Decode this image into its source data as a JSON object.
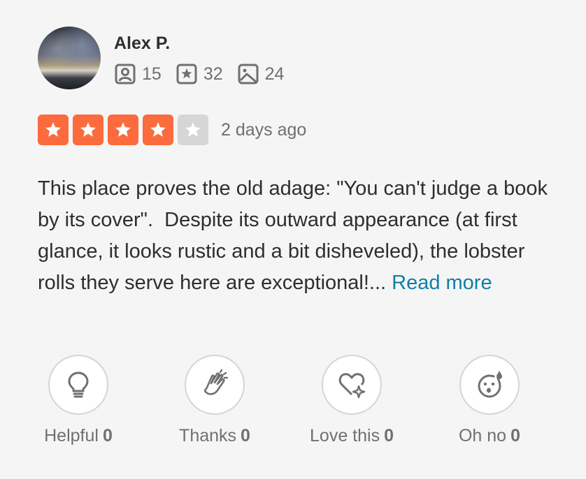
{
  "user": {
    "name": "Alex P.",
    "stats": [
      {
        "icon": "friends-icon",
        "value": "15"
      },
      {
        "icon": "reviews-icon",
        "value": "32"
      },
      {
        "icon": "photos-icon",
        "value": "24"
      }
    ]
  },
  "rating": {
    "value": 4,
    "max": 5,
    "date": "2 days ago",
    "accent_color": "#fb6b3d"
  },
  "review": {
    "text": "This place proves the old adage: \"You can't judge a book by its cover\".  Despite its outward appearance (at first glance, it looks rustic and a bit disheveled), the lobster rolls they serve here are exceptional!... ",
    "read_more": "Read more"
  },
  "reactions": [
    {
      "icon": "lightbulb-icon",
      "label": "Helpful",
      "count": "0"
    },
    {
      "icon": "clapping-hands-icon",
      "label": "Thanks",
      "count": "0"
    },
    {
      "icon": "heart-sparkle-icon",
      "label": "Love this",
      "count": "0"
    },
    {
      "icon": "surprised-face-icon",
      "label": "Oh no",
      "count": "0"
    }
  ]
}
